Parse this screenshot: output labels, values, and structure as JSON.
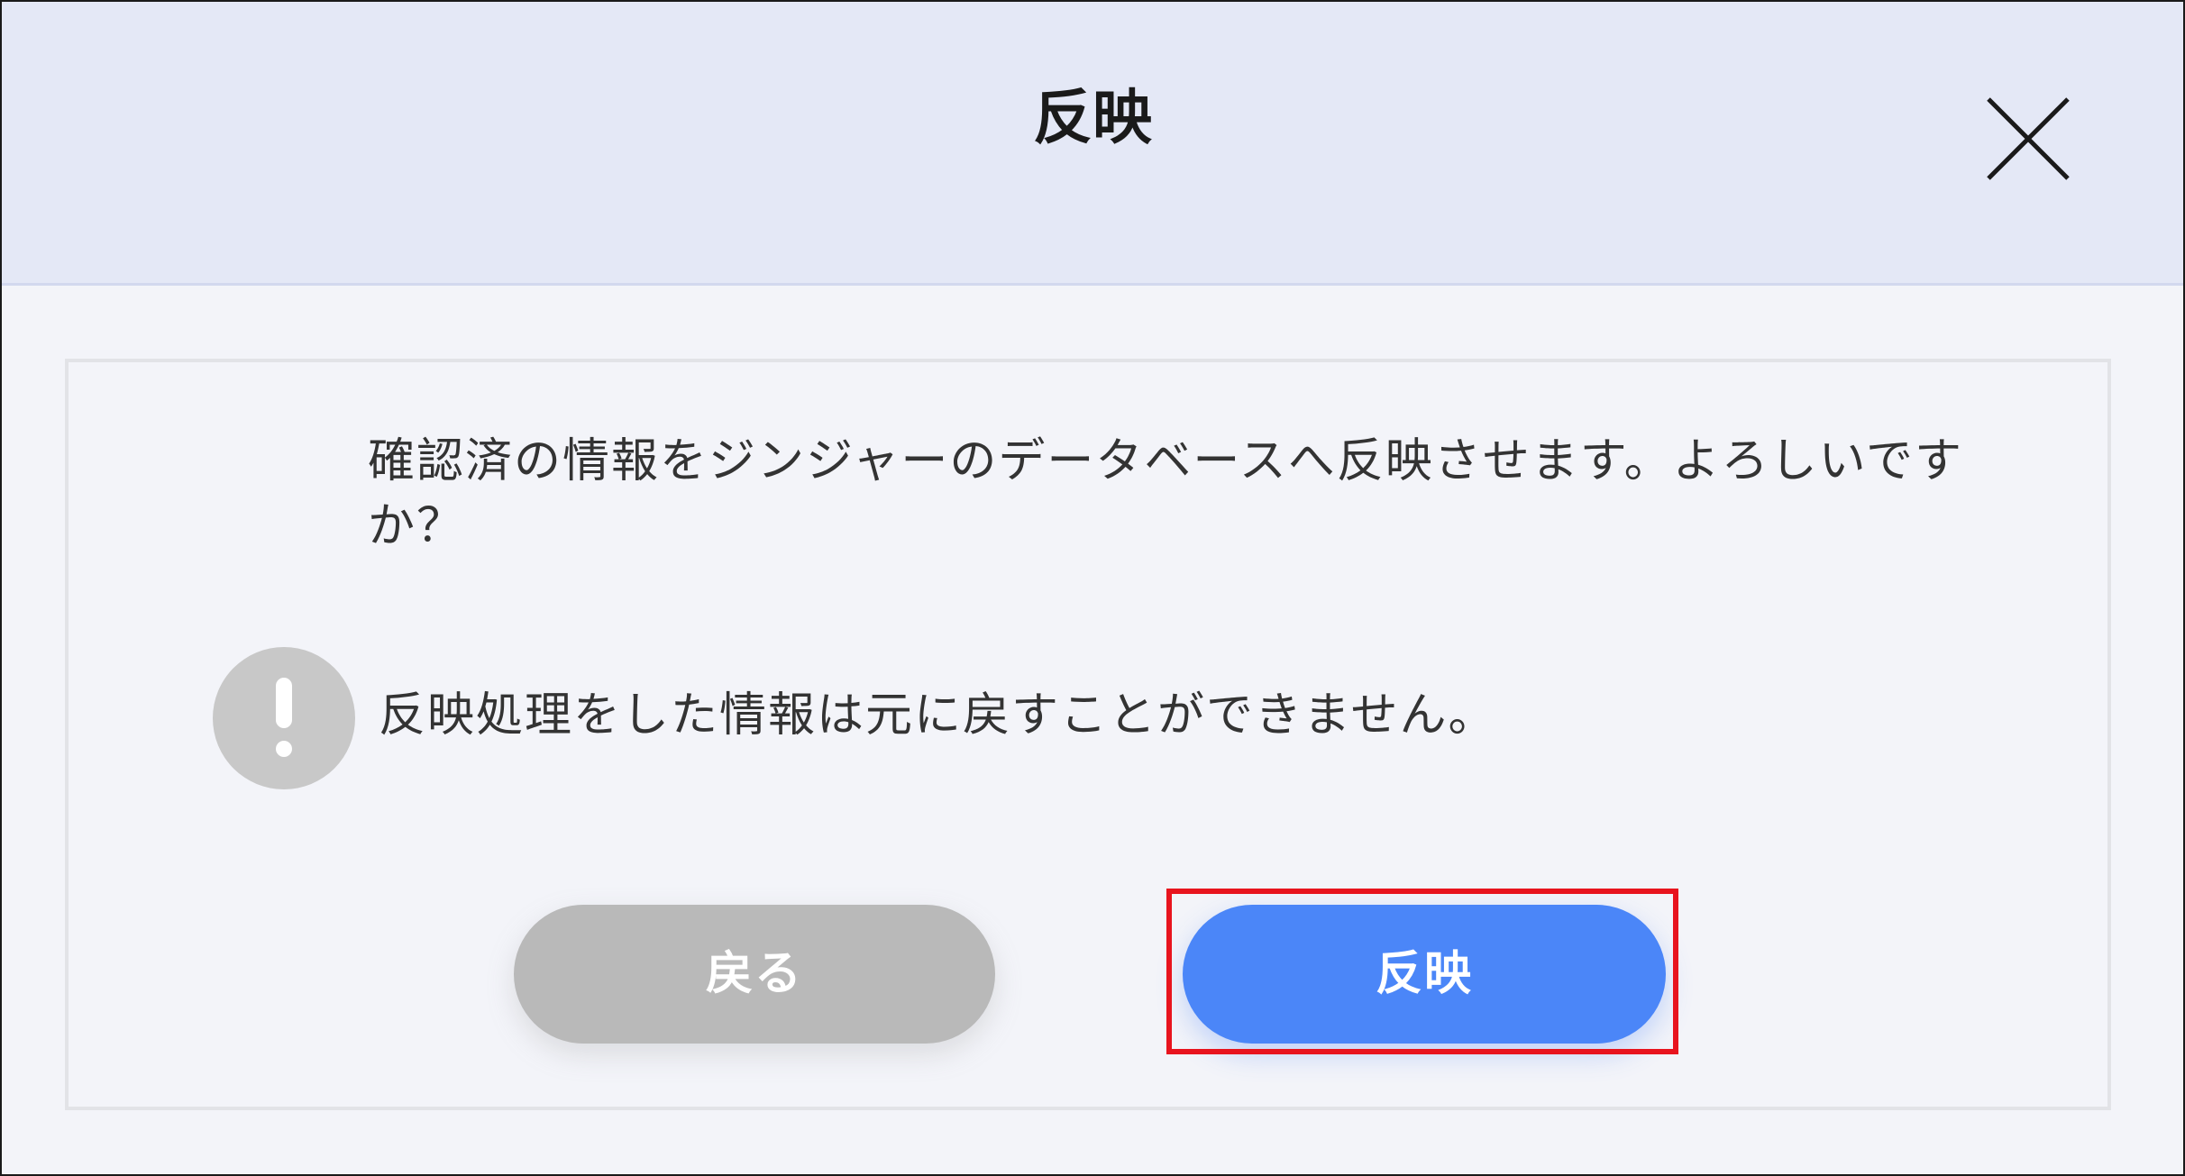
{
  "dialog": {
    "title": "反映",
    "close_icon": "close-icon",
    "message": "確認済の情報をジンジャーのデータベースへ反映させます。よろしいですか？",
    "warning_icon": "exclamation-circle-icon",
    "warning_text": "反映処理をした情報は元に戻すことができません。",
    "back_label": "戻る",
    "apply_label": "反映"
  },
  "colors": {
    "header_bg": "#e4e8f6",
    "body_bg": "#f3f4f9",
    "apply_button": "#4b86f8",
    "back_button": "#b9b9b9",
    "warning_icon": "#c8c8c8",
    "highlight": "#e8141e"
  }
}
